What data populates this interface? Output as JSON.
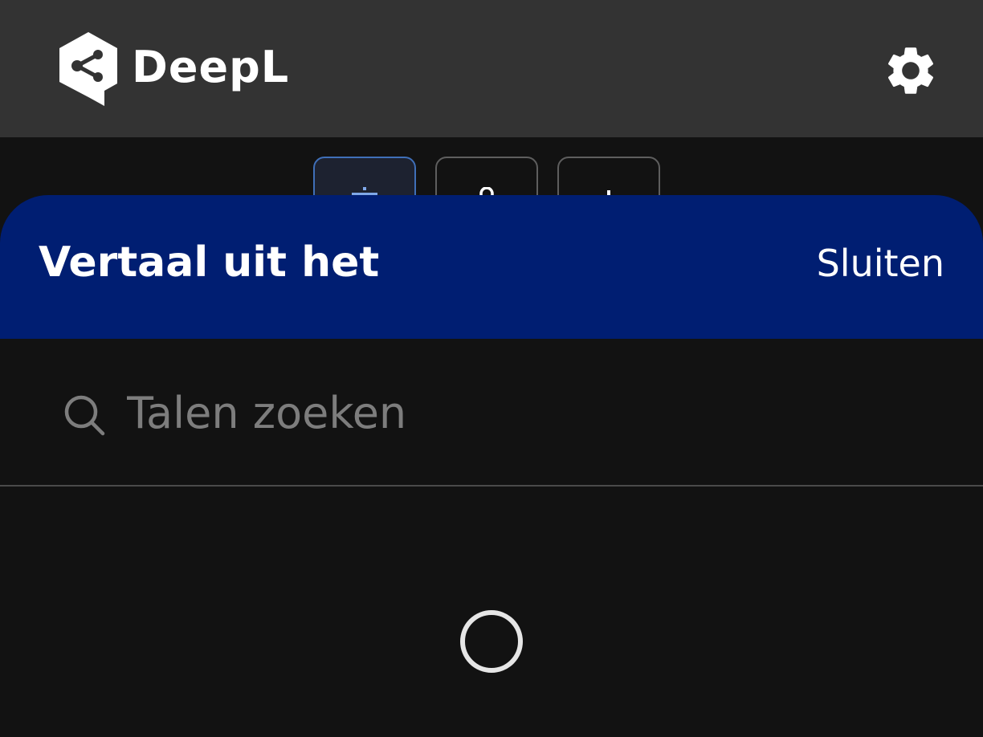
{
  "app": {
    "brand_name": "DeepL"
  },
  "colors": {
    "topbar_bg": "#333333",
    "page_bg": "#121212",
    "sheet_header_bg": "#001e72",
    "active_tab_border": "#3f6fb8",
    "tab_border": "#5e5e5e",
    "placeholder_text": "#7d7d7d"
  },
  "header": {
    "settings_icon": "gear-icon"
  },
  "mode_tabs": [
    {
      "icon": "text-translate-icon",
      "active": true
    },
    {
      "icon": "microphone-icon",
      "active": false
    },
    {
      "icon": "camera-icon",
      "active": false
    }
  ],
  "sheet": {
    "title": "Vertaal uit het",
    "close_label": "Sluiten",
    "search": {
      "placeholder": "Talen zoeken",
      "value": ""
    },
    "loading": true
  }
}
